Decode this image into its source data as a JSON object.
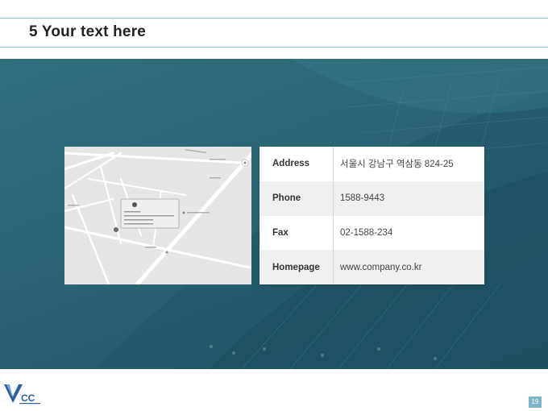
{
  "slide": {
    "title": "5 Your text here",
    "page_number": "19"
  },
  "contact_rows": [
    {
      "label": "Address",
      "value": "서울시 강남구 역삼동 824-25"
    },
    {
      "label": "Phone",
      "value": "1588-9443"
    },
    {
      "label": "Fax",
      "value": "02-1588-234"
    },
    {
      "label": "Homepage",
      "value": "www.company.co.kr"
    }
  ],
  "logo": {
    "icon": "vcc-logo-icon",
    "text": "CC"
  },
  "colors": {
    "accent_rule": "#8fcad6",
    "hero_bg": "#2a6475",
    "page_badge": "#7fb3c8"
  }
}
